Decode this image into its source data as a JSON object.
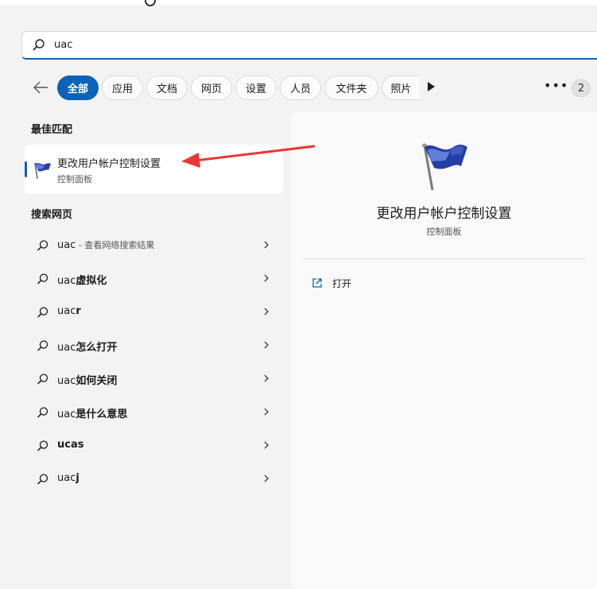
{
  "search": {
    "query": "uac"
  },
  "tabs": [
    {
      "label": "全部",
      "active": true
    },
    {
      "label": "应用"
    },
    {
      "label": "文档"
    },
    {
      "label": "网页"
    },
    {
      "label": "设置"
    },
    {
      "label": "人员"
    },
    {
      "label": "文件夹"
    },
    {
      "label": "照片"
    }
  ],
  "result_count": "2",
  "best_match": {
    "section_title": "最佳匹配",
    "title": "更改用户帐户控制设置",
    "subtitle": "控制面板"
  },
  "web_search": {
    "section_title": "搜索网页",
    "items": [
      {
        "prefix": "uac",
        "bold": "",
        "suffix": " - 查看网络搜索结果"
      },
      {
        "prefix": "uac",
        "bold": "虚拟化",
        "suffix": ""
      },
      {
        "prefix": "uac",
        "bold": "r",
        "suffix": ""
      },
      {
        "prefix": "uac",
        "bold": "怎么打开",
        "suffix": ""
      },
      {
        "prefix": "uac",
        "bold": "如何关闭",
        "suffix": ""
      },
      {
        "prefix": "uac",
        "bold": "是什么意思",
        "suffix": ""
      },
      {
        "prefix": "",
        "bold": "ucas",
        "suffix": ""
      },
      {
        "prefix": "uac",
        "bold": "j",
        "suffix": ""
      }
    ]
  },
  "detail": {
    "title": "更改用户帐户控制设置",
    "subtitle": "控制面板",
    "actions": [
      {
        "label": "打开",
        "icon": "open-external-icon"
      }
    ]
  },
  "colors": {
    "accent": "#0a63b8",
    "annotation_arrow": "#e53935"
  }
}
